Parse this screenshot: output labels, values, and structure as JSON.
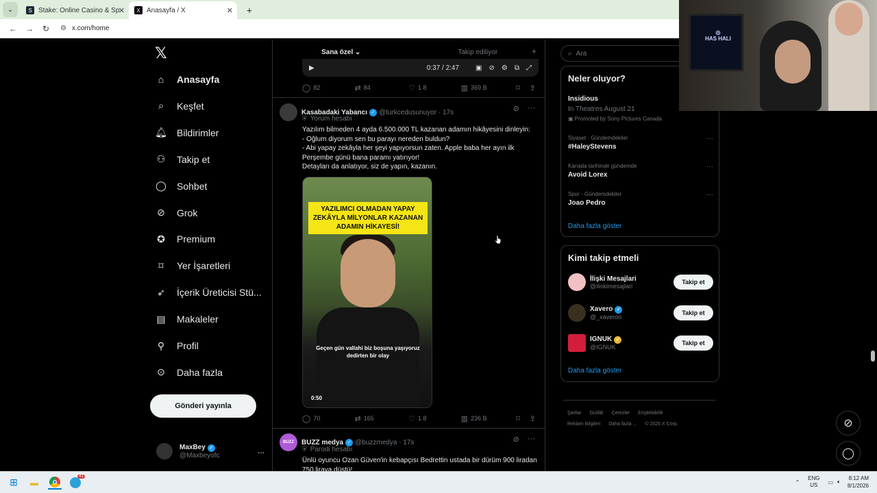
{
  "browser": {
    "tabs": [
      {
        "title": "Stake: Online Casino & Sports B",
        "favicon": "S"
      },
      {
        "title": "Anasayfa / X",
        "favicon": "X"
      }
    ],
    "url": "x.com/home",
    "new_tab": "+"
  },
  "nav": {
    "logo": "𝕏",
    "items": [
      {
        "label": "Anasayfa",
        "icon": "home-icon"
      },
      {
        "label": "Keşfet",
        "icon": "search-icon"
      },
      {
        "label": "Bildirimler",
        "icon": "bell-icon"
      },
      {
        "label": "Takip et",
        "icon": "add-user-icon"
      },
      {
        "label": "Sohbet",
        "icon": "chat-icon"
      },
      {
        "label": "Grok",
        "icon": "grok-icon"
      },
      {
        "label": "Premium",
        "icon": "premium-icon"
      },
      {
        "label": "Yer İşaretleri",
        "icon": "bookmark-icon"
      },
      {
        "label": "İçerik Üreticisi Stü...",
        "icon": "rocket-icon"
      },
      {
        "label": "Makaleler",
        "icon": "article-icon"
      },
      {
        "label": "Profil",
        "icon": "profile-icon"
      },
      {
        "label": "Daha fazla",
        "icon": "more-circle-icon"
      }
    ],
    "post_button": "Gönderi yayınla",
    "account": {
      "name": "MaxBey",
      "handle": "@Maxbeyofc",
      "more": "..."
    }
  },
  "timeline": {
    "tabs": [
      "Sana özel",
      "Takip ediliyor"
    ],
    "add_tab": "+",
    "prev_video": {
      "time": "0:37 / 2:47"
    },
    "prev_actions": {
      "replies": "82",
      "reposts": "84",
      "likes": "1 8",
      "views": "369 B"
    },
    "tweet1": {
      "name": "Kasabadaki Yabancı",
      "handle": "@turkcedusunuyor",
      "time": "· 17s",
      "label": "Yorum hesabı",
      "lines": [
        "Yazılım bilmeden 4 ayda 6.500.000 TL kazanan adamın hikâyesini dinleyin:",
        "- Oğlum diyorum sen bu parayı nereden buldun?",
        "- Abi yapay zekâyla her şeyi yapıyorsun zaten. Apple baba her ayın ilk",
        "Perşembe günü bana paramı yatırıyor!",
        "Detayları da anlatıyor, siz de yapın, kazanın."
      ],
      "video_overlay": "YAZILIMCI OLMADAN YAPAY ZEKÂYLA MİLYONLAR KAZANAN ADAMIN HİKAYESİ!",
      "video_subtitle": "Geçen gün vallahi biz boşuna yaşıyoruz dedirten bir olay",
      "video_duration": "0:50",
      "actions": {
        "replies": "70",
        "reposts": "165",
        "likes": "1 8",
        "views": "236 B"
      }
    },
    "tweet2": {
      "name": "BUZZ medya",
      "handle": "@buzzmedya",
      "time": "· 17s",
      "label": "Parodi hesabı",
      "text": "Ünlü oyuncu Ozan Güven'in kebapçısı Bedrettin ustada bir dürüm 900 liradan 750 liraya düştü!",
      "avatar_text": "BUZZ"
    }
  },
  "sidebar": {
    "search_placeholder": "Ara",
    "trending": {
      "title": "Neler oluyor?",
      "promo": {
        "title": "Insidious",
        "sub": "In Theatres August 21",
        "promoted": "Promoted by Sony Pictures Canada"
      },
      "items": [
        {
          "category": "Siyaset · Gündemdekiler",
          "topic": "#HaleyStevens"
        },
        {
          "category": "Kanada tarihinde gündemde",
          "topic": "Avoid Lorex"
        },
        {
          "category": "Spor · Gündemdekiler",
          "topic": "Joao Pedro"
        }
      ],
      "show_more": "Daha fazla göster"
    },
    "who_to_follow": {
      "title": "Kimi takip etmeli",
      "items": [
        {
          "name": "İlişki Mesajlari",
          "handle": "@iliskimesajlari",
          "button": "Takip et",
          "color": "#f1c0c4"
        },
        {
          "name": "Xavero",
          "handle": "@_xaveroo",
          "button": "Takip et",
          "color": "#3a3020"
        },
        {
          "name": "IGNUK",
          "handle": "@IGNUK",
          "button": "Takip et",
          "color": "#d21e3c"
        }
      ],
      "show_more": "Daha fazla göster"
    },
    "footer": {
      "row1": [
        "Şartlar",
        "Gizlilik",
        "Çerezler",
        "Erişilebilirlik"
      ],
      "row2": [
        "Reklam Bilgileri",
        "Daha fazla ...",
        "© 2026 X Corp."
      ]
    }
  },
  "webcam": {
    "logo_text": "HAS HALI"
  },
  "taskbar": {
    "lang": "ENG",
    "region": "US",
    "time": "8:12 AM",
    "date": "8/1/2026",
    "badge": "41"
  },
  "colors": {
    "accent": "#1d9bf0",
    "background": "#000000",
    "border": "#2f3336"
  }
}
